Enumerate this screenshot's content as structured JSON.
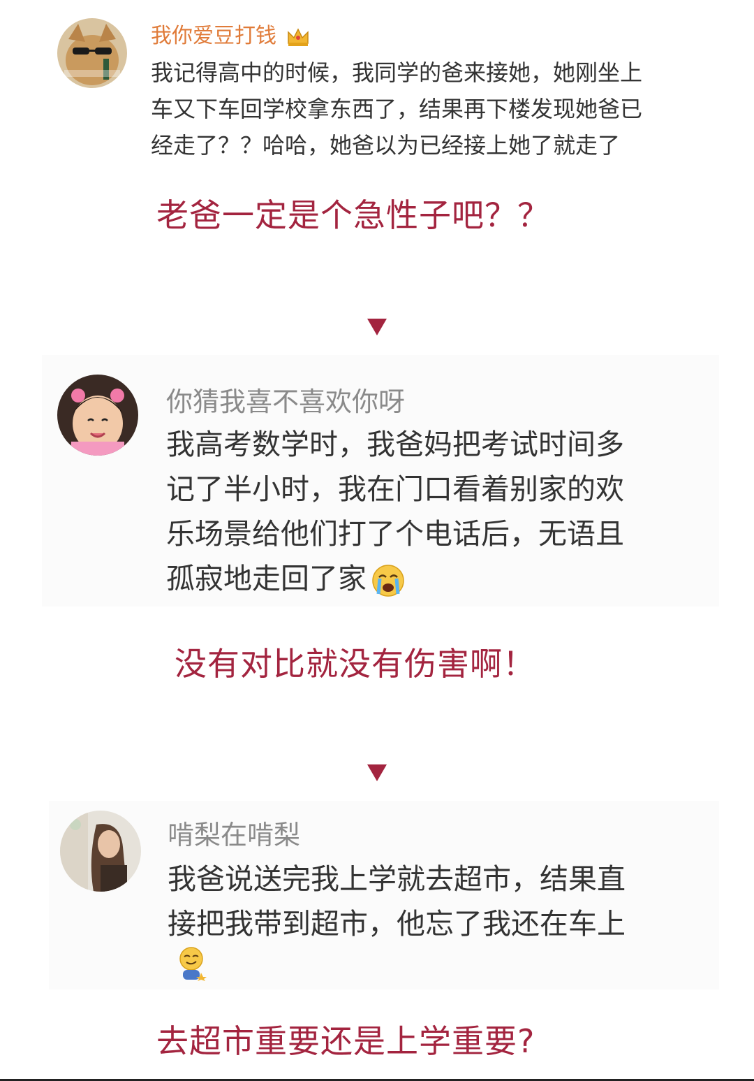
{
  "comments": [
    {
      "username": "我你爱豆打钱",
      "body_lines": [
        "我记得高中的时候，我同学的爸来接她，她刚坐上",
        "车又下车回学校拿东西了，结果再下楼发现她爸已",
        "经走了？？哈哈，她爸以为已经接上她了就走了"
      ],
      "caption": "老爸一定是个急性子吧？？"
    },
    {
      "username": "你猜我喜不喜欢你呀",
      "body_lines": [
        "我高考数学时，我爸妈把考试时间多",
        "记了半小时，我在门口看着别家的欢",
        "乐场景给他们打了个电话后，无语且",
        "孤寂地走回了家"
      ],
      "caption": "没有对比就没有伤害啊！"
    },
    {
      "username": "啃梨在啃梨",
      "body_lines": [
        "我爸说送完我上学就去超市，结果直",
        "接把我带到超市，他忘了我还在车上"
      ],
      "caption": "去超市重要还是上学重要?"
    }
  ],
  "colors": {
    "caption": "#a3243f",
    "username_1": "#e07b39",
    "username_gray": "#8a8a8a",
    "body_text": "#333333"
  },
  "icons": {
    "crown": "crown-icon",
    "crying": "crying-face-emoji",
    "smirk": "smirk-emoji",
    "arrow": "triangle-down-icon"
  }
}
